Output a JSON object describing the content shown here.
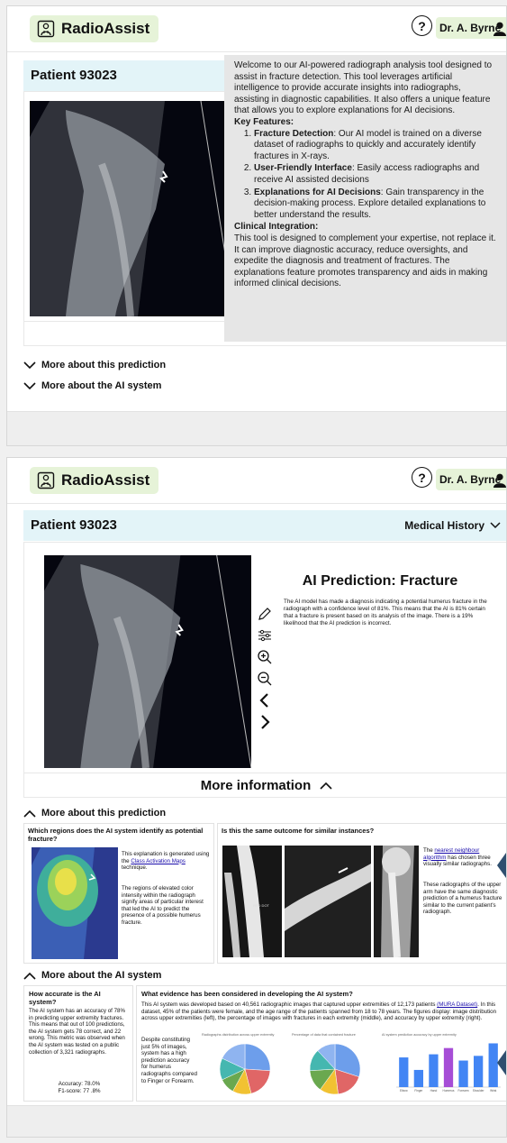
{
  "app": {
    "name": "RadioAssist",
    "help_label": "?",
    "user_name": "Dr. A. Byrne"
  },
  "patient": {
    "title": "Patient 93023",
    "history_label": "Medical History"
  },
  "tooltip": {
    "intro": "Welcome to our AI-powered radiograph analysis tool designed to assist in fracture detection. This tool leverages artificial intelligence to provide accurate insights into radiographs, assisting in diagnostic capabilities. It also offers a unique feature that allows you to explore explanations for AI decisions.",
    "features_heading": "Key Features:",
    "features": [
      {
        "title": "Fracture Detection",
        "text": ": Our AI model is trained on a diverse dataset of radiographs to quickly and accurately identify fractures in X-rays."
      },
      {
        "title": "User-Friendly Interface",
        "text": ": Easily access radiographs and receive AI assisted decisions"
      },
      {
        "title": "Explanations for AI Decisions",
        "text": ": Gain transparency in the decision-making process. Explore detailed explanations to better understand the results."
      }
    ],
    "clinical_heading": "Clinical Integration:",
    "clinical_text": "This tool is designed to complement your expertise, not replace it. It can improve diagnostic accuracy, reduce oversights, and expedite the diagnosis and treatment of fractures. The explanations feature promotes transparency and aids in making informed clinical decisions."
  },
  "prediction": {
    "title": "AI Prediction: Fracture",
    "text": "The AI model has made a diagnosis indicating a potential humerus fracture in the radiograph with a confidence level of 81%. This means that the AI is 81% certain that a fracture is present based on its analysis of the image. There is a 19% likelihood that the AI prediction is incorrect."
  },
  "more_info_label": "More information",
  "more_info_clipped": "Mo",
  "sections": {
    "prediction": "More about this prediction",
    "ai_system": "More about the AI system"
  },
  "regions": {
    "heading": "Which regions does the AI system identify as potential fracture?",
    "text1_pre": "This explanation is generated using the ",
    "text1_link": "Class Activation Maps",
    "text1_post": " technique.",
    "text2": "The regions of elevated color intensity within the radiograph signify areas of particular interest that led the AI to predict the presence of a possible humerus fracture."
  },
  "similar": {
    "heading": "Is this the same outcome for similar instances?",
    "text1_pre": "The ",
    "text1_link": "nearest neighbour algorithm",
    "text1_post": " has chosen three visually similar radiographs.",
    "text2": "These radiographs of the upper arm have the same diagnostic prediction of a humerus fracture similar to the current patient's radiograph."
  },
  "accuracy": {
    "heading": "How accurate is the AI system?",
    "text": "The AI system has an accuracy of 78% in predicting upper extremity fractures. This means that out of 100 predictions, the AI system gets 78 correct, and 22 wrong. This metric was observed when the AI system was tested on a public collection of 3,321 radiographs.",
    "accuracy_line": "Accuracy: 78.0%",
    "f1_line": "F1-score: 77 .8%"
  },
  "evidence": {
    "heading": "What evidence has been considered in developing the AI system?",
    "text_pre": "This AI system was developed based on 40,561 radiographic images that captured upper extremities of 12,173 patients ",
    "text_link": "(MURA Dataset)",
    "text_post": ". In this dataset, 45% of the patients were female, and the age range of the patients spanned from 18 to 78 years. The figures display: image distribution across upper extremities (left), the percentage of images with fractures in each extremity (middle), and accuracy by upper extremity (right).",
    "side_text": "Despite constituting just 5% of images, system has a high prediction accuracy for humerus radiographs compared to Finger or Forearm.",
    "chart1_title": "Radiographs distribution across upper extremity",
    "chart2_title": "Percentage of data that contained fracture",
    "chart3_title": "AI system prediction accuracy by upper extremity"
  },
  "chart_data": [
    {
      "type": "pie",
      "title": "Radiographs distribution across upper extremity",
      "values": [
        26,
        20,
        12,
        10,
        14,
        18
      ],
      "colors": [
        "#6d9eeb",
        "#e06666",
        "#f1c232",
        "#6aa84f",
        "#45b7b0",
        "#8fb4f0"
      ]
    },
    {
      "type": "pie",
      "title": "Percentage of data that contained fracture",
      "values": [
        30,
        18,
        12,
        14,
        14,
        12
      ],
      "colors": [
        "#6d9eeb",
        "#e06666",
        "#f1c232",
        "#6aa84f",
        "#45b7b0",
        "#8fb4f0"
      ]
    },
    {
      "type": "bar",
      "title": "AI system prediction accuracy by upper extremity",
      "categories": [
        "Elbow",
        "Finger",
        "Hand",
        "Humerus",
        "Forearm",
        "Shoulder",
        "Wrist"
      ],
      "values": [
        0.79,
        0.71,
        0.81,
        0.85,
        0.77,
        0.8,
        0.88
      ],
      "colors": [
        "#4285f4",
        "#4285f4",
        "#4285f4",
        "#a64dd6",
        "#4285f4",
        "#4285f4",
        "#4285f4"
      ],
      "ylim": [
        0.6,
        0.9
      ]
    }
  ]
}
